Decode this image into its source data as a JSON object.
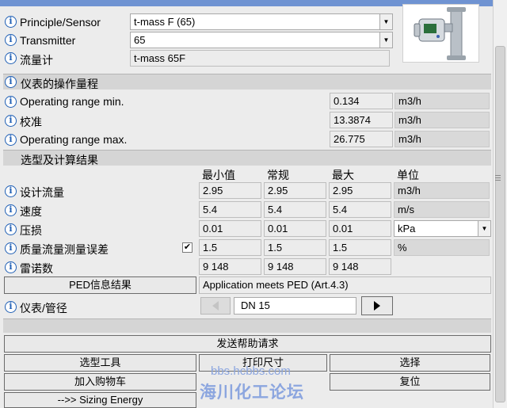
{
  "header": {
    "principle_label": "Principle/Sensor",
    "principle_value": "t-mass F (65)",
    "transmitter_label": "Transmitter",
    "transmitter_value": "65",
    "flowmeter_label": "流量计",
    "flowmeter_value": "t-mass 65F"
  },
  "operating_range": {
    "title": "仪表的操作量程",
    "rows": [
      {
        "label": "Operating range min.",
        "value": "0.134",
        "unit": "m3/h"
      },
      {
        "label": "校准",
        "value": "13.3874",
        "unit": "m3/h"
      },
      {
        "label": "Operating range max.",
        "value": "26.775",
        "unit": "m3/h"
      }
    ]
  },
  "results": {
    "title": "选型及计算结果",
    "columns": [
      "最小值",
      "常规",
      "最大",
      "单位"
    ],
    "rows": [
      {
        "label": "设计流量",
        "min": "2.95",
        "normal": "2.95",
        "max": "2.95",
        "unit": "m3/h"
      },
      {
        "label": "速度",
        "min": "5.4",
        "normal": "5.4",
        "max": "5.4",
        "unit": "m/s"
      },
      {
        "label": "压损",
        "min": "0.01",
        "normal": "0.01",
        "max": "0.01",
        "unit": "kPa"
      },
      {
        "label": "质量流量测量误差",
        "min": "1.5",
        "normal": "1.5",
        "max": "1.5",
        "unit": "%",
        "checked": "✔"
      },
      {
        "label": "雷诺数",
        "min": "9 148",
        "normal": "9 148",
        "max": "9 148",
        "unit": ""
      }
    ]
  },
  "ped": {
    "button_label": "PED信息结果",
    "result_text": "Application meets PED (Art.4.3)"
  },
  "pipe": {
    "label": "仪表/管径",
    "value": "DN 15",
    "prev_icon": "arrow-left-icon",
    "next_icon": "arrow-right-icon"
  },
  "buttons": {
    "help_request": "发送帮助请求",
    "selection_tool": "选型工具",
    "print_dimensions": "打印尺寸",
    "select": "选择",
    "add_to_cart": "加入购物车",
    "reset": "复位",
    "sizing_energy": "-->> Sizing Energy"
  },
  "watermark": {
    "url": "bbs.hcbbs.com",
    "name": "海川化工论坛"
  },
  "icons": {
    "info": "i",
    "dropdown": "▼"
  },
  "colors": {
    "title_bar": "#6f93d2",
    "info_icon": "#1f5fb5",
    "section_bg": "#d5d5d5",
    "watermark": "#8ca6df"
  }
}
